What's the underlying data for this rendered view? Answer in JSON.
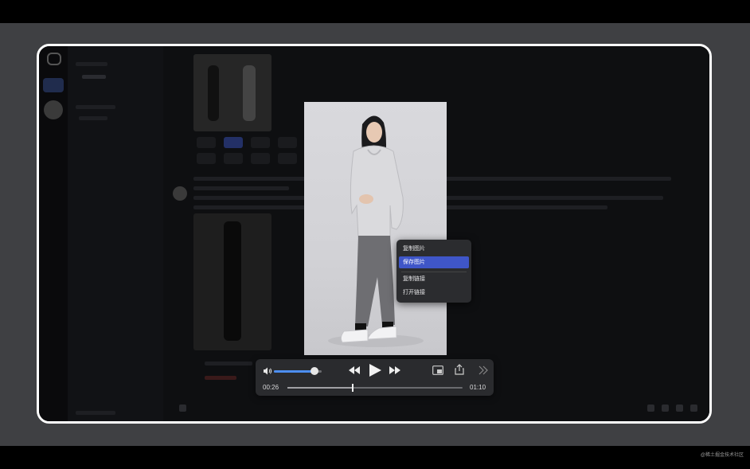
{
  "context_menu": {
    "items": [
      {
        "label": "复制图片"
      },
      {
        "label": "保存图片"
      },
      {
        "label": "复制链接"
      },
      {
        "label": "打开链接"
      }
    ],
    "active_index": 1
  },
  "player": {
    "current_time": "00:26",
    "duration": "01:10",
    "progress": 0.37,
    "volume": 0.85
  },
  "watermark": "@稀土掘金技术社区",
  "colors": {
    "accent": "#3f56c8",
    "volume_fill": "#4d8ef0"
  }
}
